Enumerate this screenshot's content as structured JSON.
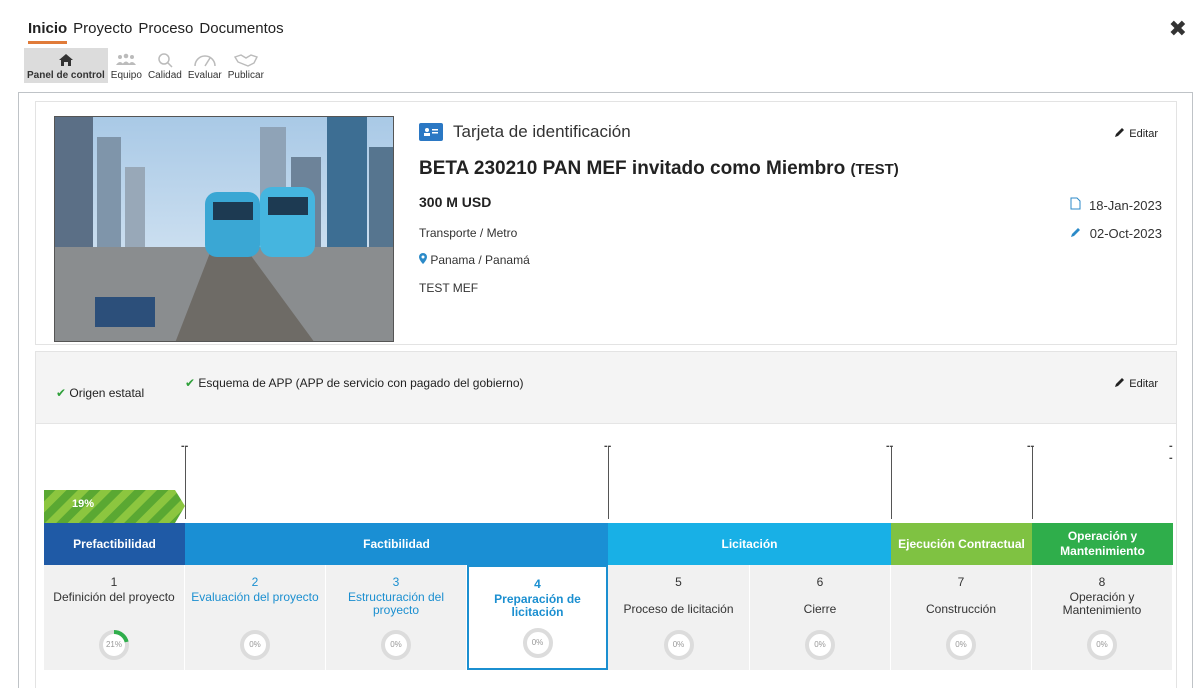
{
  "nav": {
    "tabs": [
      "Inicio",
      "Proyecto",
      "Proceso",
      "Documentos"
    ],
    "close_icon": "✖"
  },
  "toolbar": {
    "items": [
      "Panel de control",
      "Equipo",
      "Calidad",
      "Evaluar",
      "Publicar"
    ]
  },
  "card": {
    "header": "Tarjeta de identificación",
    "edit_label": "Editar",
    "title": "BETA 230210 PAN MEF invitado como Miembro",
    "title_tag": "(TEST)",
    "amount": "300 M USD",
    "sector": "Transporte / Metro",
    "location": "Panama / Panamá",
    "owner": "TEST MEF",
    "created_date": "18-Jan-2023",
    "modified_date": "02-Oct-2023"
  },
  "scheme": {
    "origin": "Origen estatal",
    "app_scheme": "Esquema de APP (APP de servicio con pagado del gobierno)",
    "edit_label": "Editar"
  },
  "timeline": {
    "dash": "--",
    "progress_label": "19%",
    "progress": 0.19,
    "phases": [
      "Prefactibilidad",
      "Factibilidad",
      "Licitación",
      "Ejecución Contractual",
      "Operación y Mantenimiento"
    ],
    "stages": [
      {
        "num": "1",
        "label": "Definición del proyecto",
        "pct": "21%",
        "progress": 0.21
      },
      {
        "num": "2",
        "label": "Evaluación del proyecto",
        "pct": "0%",
        "progress": 0
      },
      {
        "num": "3",
        "label": "Estructuración del proyecto",
        "pct": "0%",
        "progress": 0
      },
      {
        "num": "4",
        "label": "Preparación de licitación",
        "pct": "0%",
        "progress": 0
      },
      {
        "num": "5",
        "label": "Proceso de licitación",
        "pct": "0%",
        "progress": 0
      },
      {
        "num": "6",
        "label": "Cierre",
        "pct": "0%",
        "progress": 0
      },
      {
        "num": "7",
        "label": "Construcción",
        "pct": "0%",
        "progress": 0
      },
      {
        "num": "8",
        "label": "Operación y Mantenimiento",
        "pct": "0%",
        "progress": 0
      }
    ]
  },
  "colors": {
    "accent_orange": "#e07b39",
    "prefactibilidad": "#1f5aa6",
    "factibilidad": "#1a8fd4",
    "licitacion": "#18b0e6",
    "ejecucion": "#7fc242",
    "operacion": "#2fae4b",
    "link_blue": "#1b8fd0"
  }
}
